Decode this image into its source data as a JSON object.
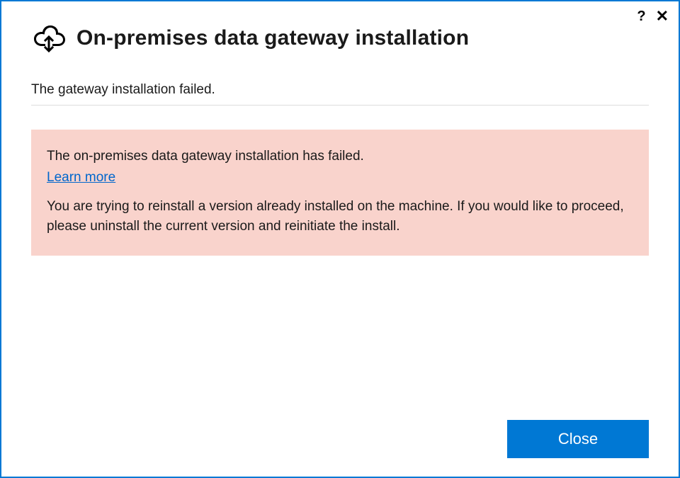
{
  "window": {
    "title": "On-premises data gateway installation",
    "status": "The gateway installation failed."
  },
  "error": {
    "headline": "The on-premises data gateway installation has failed.",
    "learn_more": "Learn more",
    "detail": "You are trying to reinstall a version already installed on the machine. If you would like to proceed, please uninstall the current version and reinitiate the install."
  },
  "buttons": {
    "close": "Close"
  },
  "titlebar": {
    "help": "?",
    "close": "✕"
  }
}
